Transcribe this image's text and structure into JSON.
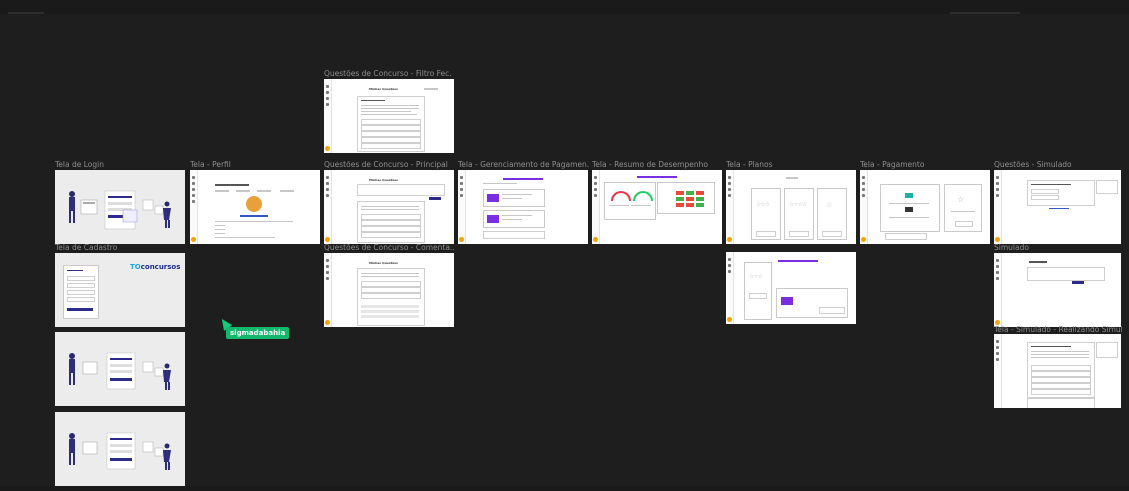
{
  "canvas": {
    "background": "#1e1e1e",
    "label_color": "#8e8e8e"
  },
  "frames": {
    "login": "Tela de Login",
    "perfil": "Tela - Perfil",
    "filtro": "Questões de Concurso - Filtro Fec...",
    "principal": "Questões de Concurso - Principal",
    "pagamentos": "Tela - Gerenciamento de Pagamen...",
    "desempenho": "Tela - Resumo de Desempenho",
    "planos": "Tela - Planos",
    "pagamento": "Tela - Pagamento",
    "simulado_q": "Questões - Simulado",
    "cadastro": "Tela de Cadastro",
    "comentarios": "Questões de Concurso - Comenta...",
    "simulado": "Simulado",
    "realizando": "Tela - Simulado - Realizando Simul..."
  },
  "mock_text": {
    "brand_main": "TO",
    "brand_accent": "concursos",
    "minhas_questoes": "Minhas Questões"
  },
  "collaborator": {
    "name": "sigmadabahia",
    "color": "#14b86c"
  },
  "colors": {
    "frame_bg": "#ffffff",
    "brand_dark": "#1d2b8f",
    "brand_light": "#1ea6e6",
    "accent_purple": "#7b2ee0",
    "button_navy": "#2b2b8c",
    "avatar_orange": "#f0a400"
  }
}
